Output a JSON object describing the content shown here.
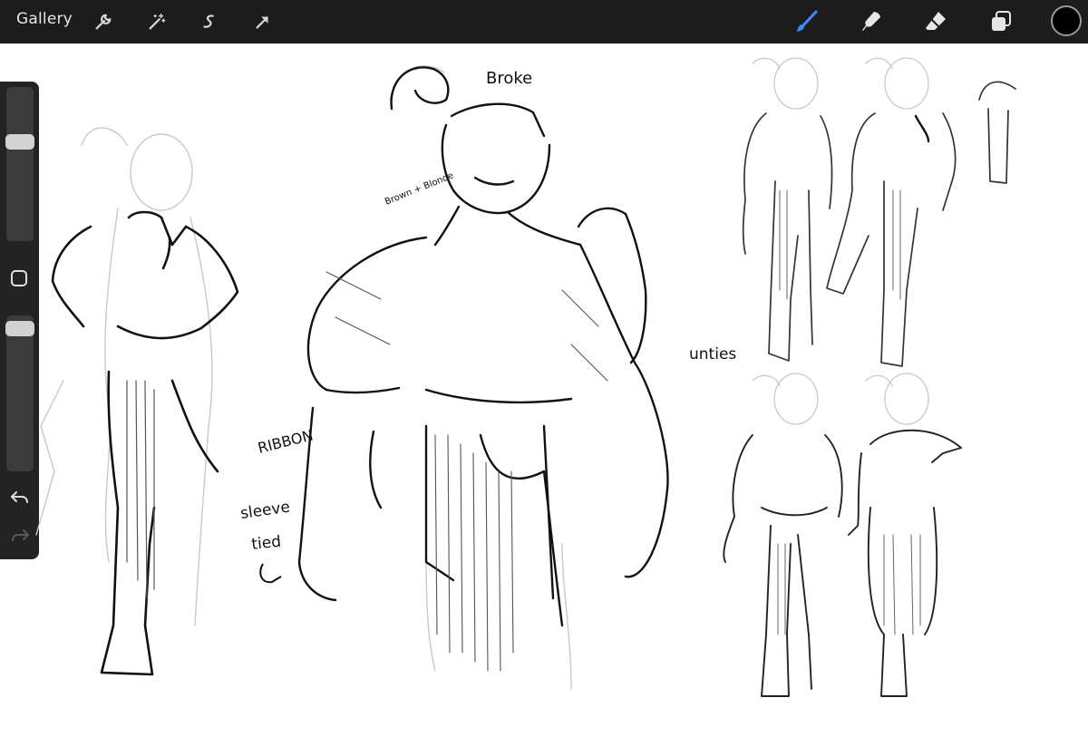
{
  "toolbar": {
    "gallery_label": "Gallery",
    "left_tools": [
      "wrench-icon",
      "magic-wand-icon",
      "selection-icon",
      "arrow-icon"
    ],
    "right_tools": [
      "brush-icon",
      "smudge-icon",
      "eraser-icon",
      "layers-icon"
    ],
    "active_tool": "brush-icon",
    "accent_color": "#3d8bff",
    "current_color": "#000000"
  },
  "sidebar": {
    "brush_size_level": 0.66,
    "opacity_level": 0.96,
    "modify_button": "square-icon",
    "undo": "undo-icon",
    "redo": "redo-icon"
  },
  "canvas": {
    "notes": {
      "broke": "Broke",
      "hair": "Brown + Blonde",
      "ribbon": "RIBBON",
      "sleeve": "sleeve",
      "tied": "tied",
      "unties": "unties"
    }
  }
}
